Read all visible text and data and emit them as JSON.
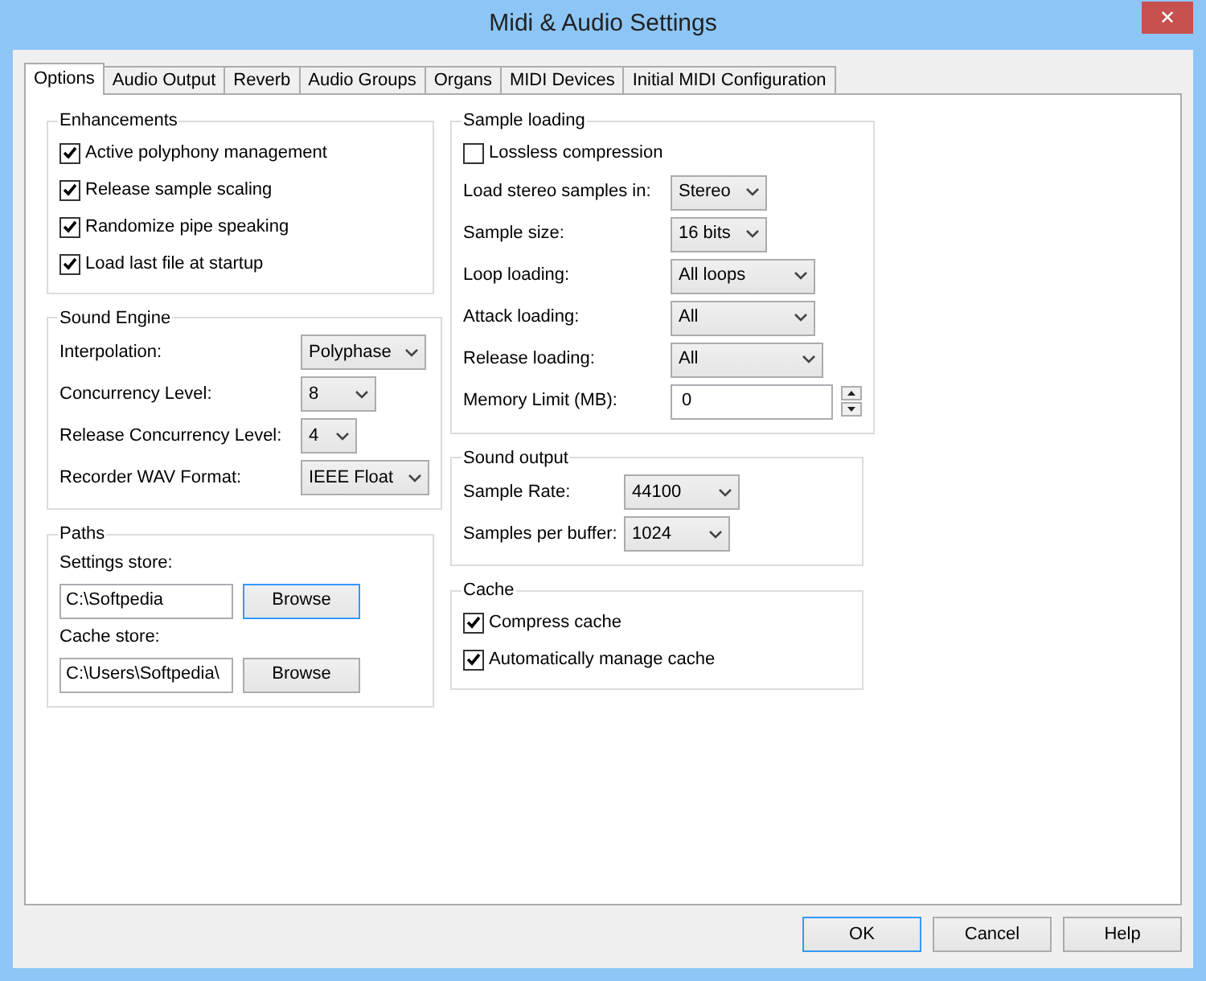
{
  "window": {
    "title": "Midi & Audio Settings",
    "close": "✕"
  },
  "tabs": [
    {
      "label": "Options",
      "selected": true
    },
    {
      "label": "Audio Output",
      "selected": false
    },
    {
      "label": "Reverb",
      "selected": false
    },
    {
      "label": "Audio Groups",
      "selected": false
    },
    {
      "label": "Organs",
      "selected": false
    },
    {
      "label": "MIDI Devices",
      "selected": false
    },
    {
      "label": "Initial MIDI Configuration",
      "selected": false
    }
  ],
  "left_groups": [
    {
      "title": "Enhancements",
      "items": [
        {
          "kind": "checkbox",
          "label": "Active polyphony management",
          "checked": true
        },
        {
          "kind": "checkbox",
          "label": "Release sample scaling",
          "checked": true
        },
        {
          "kind": "checkbox",
          "label": "Randomize pipe speaking",
          "checked": true
        },
        {
          "kind": "checkbox",
          "label": "Load last file at startup",
          "checked": true
        }
      ]
    },
    {
      "title": "Sound Engine",
      "items": [
        {
          "kind": "dropdown",
          "label": "Interpolation:",
          "value": "Polyphase"
        },
        {
          "kind": "dropdown",
          "label": "Concurrency Level:",
          "value": "8"
        },
        {
          "kind": "dropdown",
          "label": "Release Concurrency Level:",
          "value": "4"
        },
        {
          "kind": "dropdown",
          "label": "Recorder WAV Format:",
          "value": "IEEE Float"
        }
      ]
    },
    {
      "title": "Paths",
      "items": [
        {
          "kind": "path",
          "label": "Settings store:",
          "value": "C:\\Softpedia",
          "button": "Browse",
          "focused": true
        },
        {
          "kind": "path",
          "label": "Cache store:",
          "value": "C:\\Users\\Softpedia\\",
          "button": "Browse",
          "focused": false
        }
      ]
    }
  ],
  "right_groups": [
    {
      "title": "Sample loading",
      "items": [
        {
          "kind": "checkbox",
          "label": "Lossless compression",
          "checked": false
        },
        {
          "kind": "dropdown",
          "label": "Load stereo samples in:",
          "value": "Stereo"
        },
        {
          "kind": "dropdown",
          "label": "Sample size:",
          "value": "16 bits"
        },
        {
          "kind": "dropdown",
          "label": "Loop loading:",
          "value": "All loops"
        },
        {
          "kind": "dropdown",
          "label": "Attack loading:",
          "value": "All"
        },
        {
          "kind": "dropdown",
          "label": "Release loading:",
          "value": "All"
        },
        {
          "kind": "spin",
          "label": "Memory Limit (MB):",
          "value": "0"
        }
      ]
    },
    {
      "title": "Sound output",
      "items": [
        {
          "kind": "dropdown",
          "label": "Sample Rate:",
          "value": "44100"
        },
        {
          "kind": "dropdown",
          "label": "Samples per buffer:",
          "value": "1024"
        }
      ]
    },
    {
      "title": "Cache",
      "items": [
        {
          "kind": "checkbox",
          "label": "Compress cache",
          "checked": true
        },
        {
          "kind": "checkbox",
          "label": "Automatically manage cache",
          "checked": true
        }
      ]
    }
  ],
  "buttons": [
    "OK",
    "Cancel",
    "Help"
  ]
}
